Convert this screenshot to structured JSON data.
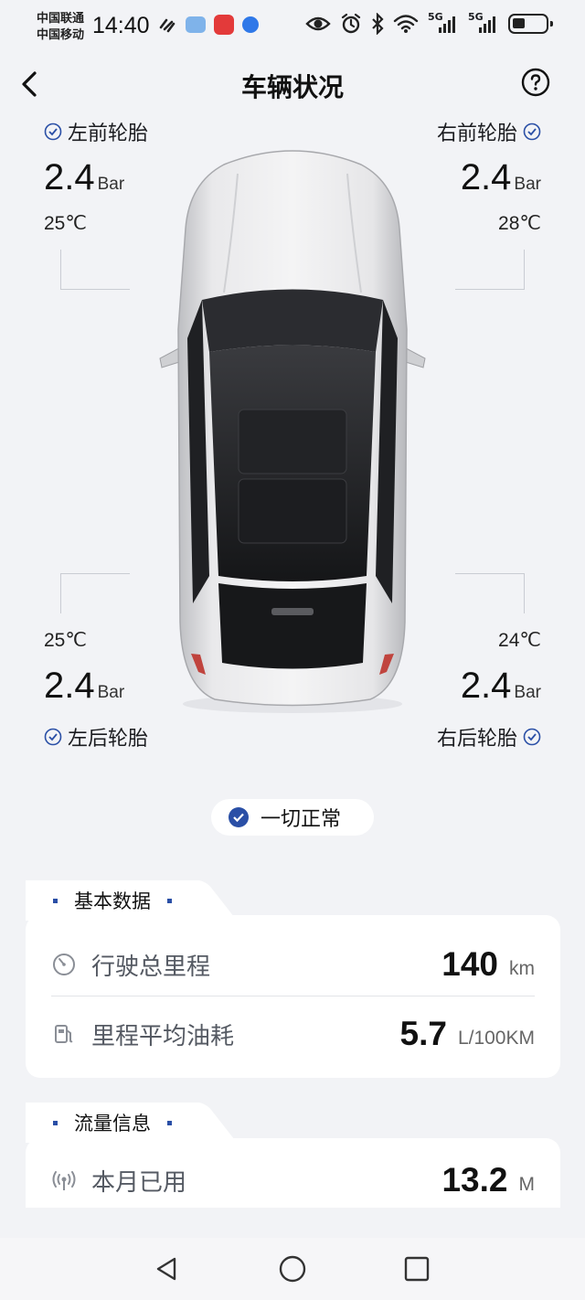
{
  "status_bar": {
    "carrier_1": "中国联通",
    "carrier_2": "中国移动",
    "time": "14:40",
    "network_1": "5G",
    "network_2": "5G"
  },
  "header": {
    "title": "车辆状况"
  },
  "tires": {
    "front_left": {
      "label": "左前轮胎",
      "pressure": "2.4",
      "unit": "Bar",
      "temp": "25℃"
    },
    "front_right": {
      "label": "右前轮胎",
      "pressure": "2.4",
      "unit": "Bar",
      "temp": "28℃"
    },
    "rear_left": {
      "label": "左后轮胎",
      "pressure": "2.4",
      "unit": "Bar",
      "temp": "25℃"
    },
    "rear_right": {
      "label": "右后轮胎",
      "pressure": "2.4",
      "unit": "Bar",
      "temp": "24℃"
    }
  },
  "status": {
    "text": "一切正常"
  },
  "basic_data": {
    "title": "基本数据",
    "mileage": {
      "label": "行驶总里程",
      "value": "140",
      "unit": "km"
    },
    "fuel": {
      "label": "里程平均油耗",
      "value": "5.7",
      "unit": "L/100KM"
    }
  },
  "traffic": {
    "title": "流量信息",
    "monthly": {
      "label": "本月已用",
      "value": "13.2",
      "unit": "M"
    }
  },
  "colors": {
    "accent": "#2a4fa6",
    "background": "#f2f3f6",
    "card": "#ffffff"
  }
}
